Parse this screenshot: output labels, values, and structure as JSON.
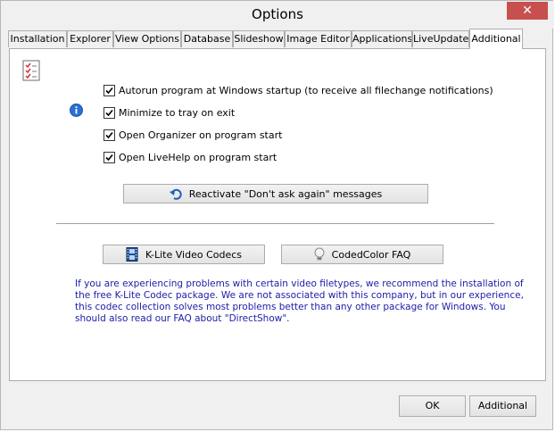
{
  "window": {
    "title": "Options",
    "close_glyph": "✕"
  },
  "tabs": [
    {
      "label": "Installation",
      "active": false
    },
    {
      "label": "Explorer",
      "active": false
    },
    {
      "label": "View Options",
      "active": false
    },
    {
      "label": "Database",
      "active": false
    },
    {
      "label": "Slideshow",
      "active": false
    },
    {
      "label": "Image Editor",
      "active": false
    },
    {
      "label": "Applications",
      "active": false
    },
    {
      "label": "LiveUpdate",
      "active": false
    },
    {
      "label": "Additional",
      "active": true
    }
  ],
  "options": [
    {
      "label": "Autorun program at Windows startup (to receive all filechange notifications)",
      "checked": true
    },
    {
      "label": "Minimize to tray on exit",
      "checked": true
    },
    {
      "label": "Open Organizer on program start",
      "checked": true
    },
    {
      "label": "Open LiveHelp on program start",
      "checked": true
    }
  ],
  "buttons": {
    "reactivate": "Reactivate \"Don't ask again\" messages",
    "klite": "K-Lite Video Codecs",
    "faq": "CodedColor FAQ",
    "ok": "OK",
    "cancel": "Additional"
  },
  "note": "If you are experiencing problems with certain video filetypes, we recommend the installation of the free K-Lite Codec package. We are not associated with this company, but in our experience, this codec collection solves most problems better than any other package for Windows. You should also read our FAQ about \"DirectShow\".",
  "icons": {
    "checklist": "checklist-icon",
    "info": "info-icon",
    "reactivate": "undo-arrow-icon",
    "klite": "film-strip-icon",
    "faq": "light-bulb-icon"
  },
  "colors": {
    "note_text": "#1c1ca8",
    "close_button": "#c7504f",
    "info_icon": "#2a6fd6"
  }
}
